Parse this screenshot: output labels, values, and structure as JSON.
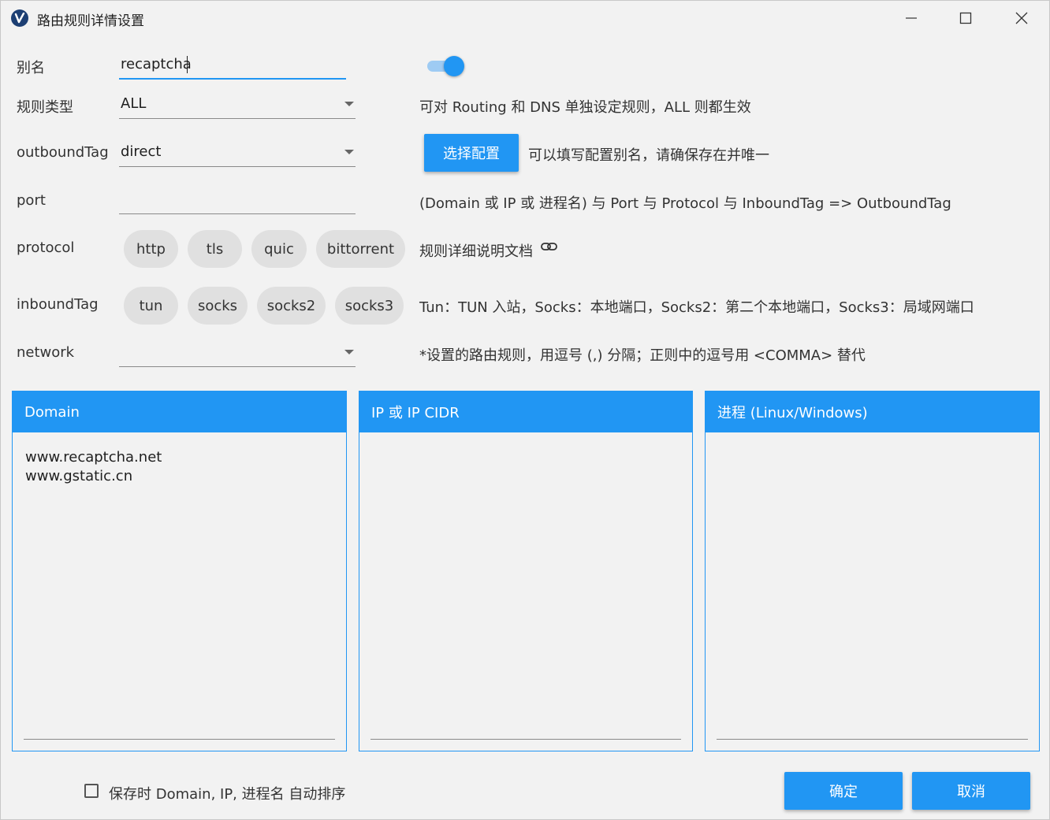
{
  "window": {
    "title": "路由规则详情设置"
  },
  "form": {
    "alias_label": "别名",
    "alias_value": "recaptcha",
    "rule_type_label": "规则类型",
    "rule_type_value": "ALL",
    "outbound_tag_label": "outboundTag",
    "outbound_tag_value": "direct",
    "port_label": "port",
    "port_value": "",
    "protocol_label": "protocol",
    "protocol_options": [
      "http",
      "tls",
      "quic",
      "bittorrent"
    ],
    "inbound_tag_label": "inboundTag",
    "inbound_tag_options": [
      "tun",
      "socks",
      "socks2",
      "socks3"
    ],
    "network_label": "network",
    "network_value": "",
    "enabled": true
  },
  "hints": {
    "rule_type": "可对 Routing 和 DNS 单独设定规则，ALL 则都生效",
    "select_config_button": "选择配置",
    "outbound_tag": "可以填写配置别名，请确保存在并唯一",
    "port": "(Domain 或 IP 或 进程名) 与 Port 与 Protocol 与 InboundTag => OutboundTag",
    "protocol_doc_link": "规则详细说明文档",
    "inbound_tag": "Tun：TUN 入站，Socks：本地端口，Socks2：第二个本地端口，Socks3：局域网端口",
    "network": "*设置的路由规则，用逗号 (,) 分隔；正则中的逗号用 <COMMA> 替代"
  },
  "panels": [
    {
      "title": "Domain",
      "content": "www.recaptcha.net\nwww.gstatic.cn"
    },
    {
      "title": "IP 或 IP CIDR",
      "content": ""
    },
    {
      "title": "进程 (Linux/Windows)",
      "content": ""
    }
  ],
  "footer": {
    "auto_sort_label": "保存时 Domain, IP, 进程名 自动排序",
    "auto_sort_checked": false,
    "ok_button": "确定",
    "cancel_button": "取消"
  },
  "colors": {
    "accent": "#2196f3",
    "background": "#f2f2f2"
  }
}
